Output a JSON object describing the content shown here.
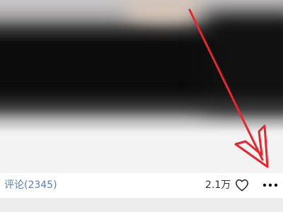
{
  "post": {
    "comments_label": "评论(2345)",
    "like_count": "2.1万"
  },
  "icons": {
    "like": "heart-outline-icon",
    "more": "more-horizontal-icon"
  },
  "colors": {
    "comments_link": "#5b7fb4",
    "text": "#333333",
    "annotation_arrow": "#e8262b",
    "divider": "#ededed"
  }
}
